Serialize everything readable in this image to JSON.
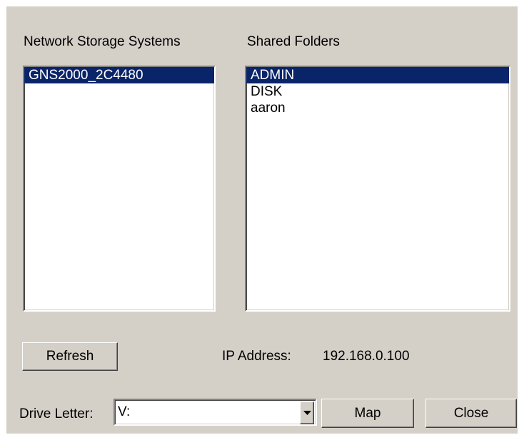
{
  "storage": {
    "label": "Network Storage Systems",
    "items": [
      {
        "label": "GNS2000_2C4480",
        "selected": true
      }
    ]
  },
  "folders": {
    "label": "Shared Folders",
    "items": [
      {
        "label": "ADMIN",
        "selected": true
      },
      {
        "label": "DISK",
        "selected": false
      },
      {
        "label": "aaron",
        "selected": false
      }
    ]
  },
  "refresh_button": "Refresh",
  "ip": {
    "label": "IP Address:",
    "value": "192.168.0.100"
  },
  "drive": {
    "label": "Drive Letter:",
    "value": "V:",
    "arrow_icon": "chevron-down-icon"
  },
  "map_button": "Map",
  "close_button": "Close",
  "colors": {
    "dialog_bg": "#d4d0c8",
    "selection_bg": "#0a246a",
    "selection_text": "#ffffff"
  }
}
